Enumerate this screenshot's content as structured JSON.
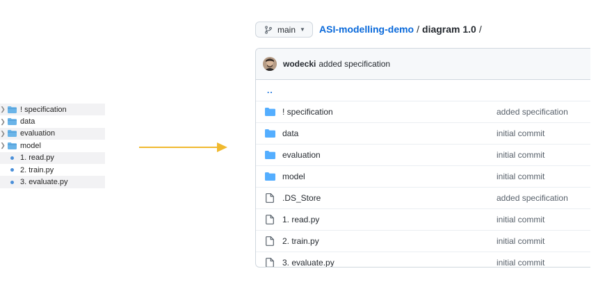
{
  "finder": {
    "items": [
      {
        "name": "! specification",
        "kind": "folder",
        "expandable": true
      },
      {
        "name": "data",
        "kind": "folder",
        "expandable": true
      },
      {
        "name": "evaluation",
        "kind": "folder",
        "expandable": true
      },
      {
        "name": "model",
        "kind": "folder",
        "expandable": true
      },
      {
        "name": "1. read.py",
        "kind": "python"
      },
      {
        "name": "2. train.py",
        "kind": "python"
      },
      {
        "name": "3. evaluate.py",
        "kind": "python"
      }
    ]
  },
  "arrow_color": "#f0b92e",
  "repo": {
    "branch": "main",
    "name": "ASI-modelling-demo",
    "separator": "/",
    "path": "diagram 1.0",
    "trailing_sep": "/"
  },
  "commit": {
    "author": "wodecki",
    "message": "added specification"
  },
  "listing": {
    "parent": "..",
    "rows": [
      {
        "name": "! specification",
        "kind": "folder",
        "message": "added specification"
      },
      {
        "name": "data",
        "kind": "folder",
        "message": "initial commit"
      },
      {
        "name": "evaluation",
        "kind": "folder",
        "message": "initial commit"
      },
      {
        "name": "model",
        "kind": "folder",
        "message": "initial commit"
      },
      {
        "name": ".DS_Store",
        "kind": "file",
        "message": "added specification"
      },
      {
        "name": "1. read.py",
        "kind": "file",
        "message": "initial commit"
      },
      {
        "name": "2. train.py",
        "kind": "file",
        "message": "initial commit"
      },
      {
        "name": "3. evaluate.py",
        "kind": "file",
        "message": "initial commit"
      }
    ]
  },
  "colors": {
    "link": "#0969da",
    "folder": "#54aeff",
    "finder_folder": "#6ab4e8"
  }
}
